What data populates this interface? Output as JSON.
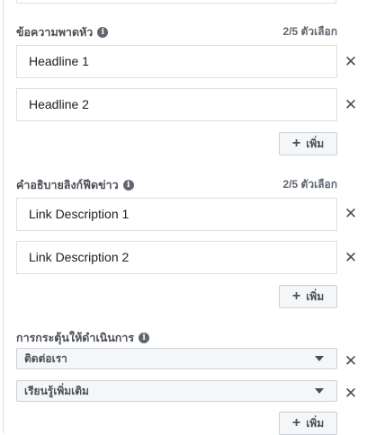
{
  "headline": {
    "title": "ข้อความพาดหัว",
    "count": "2/5 ตัวเลือก",
    "items": [
      "Headline 1",
      "Headline 2"
    ],
    "add_label": "เพิ่ม"
  },
  "link_description": {
    "title": "คำอธิบายลิงก์ฟีดข่าว",
    "count": "2/5 ตัวเลือก",
    "items": [
      "Link Description 1",
      "Link Description 2"
    ],
    "add_label": "เพิ่ม"
  },
  "call_to_action": {
    "title": "การกระตุ้นให้ดำเนินการ",
    "items": [
      "ติดต่อเรา",
      "เรียนรู้เพิ่มเติม"
    ],
    "add_label": "เพิ่ม"
  },
  "icons": {
    "info": "info-icon",
    "remove": "close-icon",
    "add": "plus-icon",
    "dropdown": "chevron-down-icon"
  }
}
